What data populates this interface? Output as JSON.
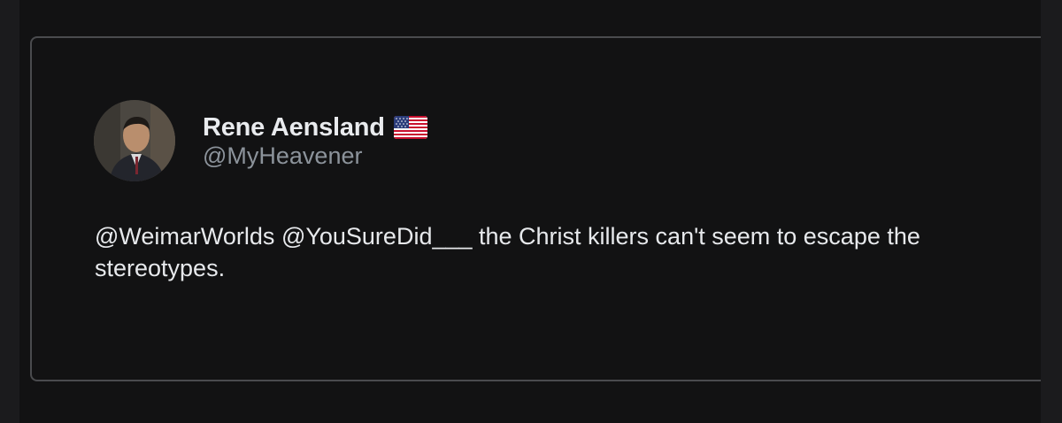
{
  "tweet": {
    "author": {
      "display_name": "Rene Aensland",
      "flag_emoji_icon": "us-flag-icon",
      "handle": "@MyHeavener"
    },
    "text_line_1": "@WeimarWorlds @YouSureDid___ the Christ killers can't seem to escape the",
    "text_line_2": "stereotypes."
  },
  "colors": {
    "background": "#121213",
    "border": "#4a4b4e",
    "name": "#e9ebee",
    "handle": "#8c939b",
    "text": "#e7e9ec"
  }
}
